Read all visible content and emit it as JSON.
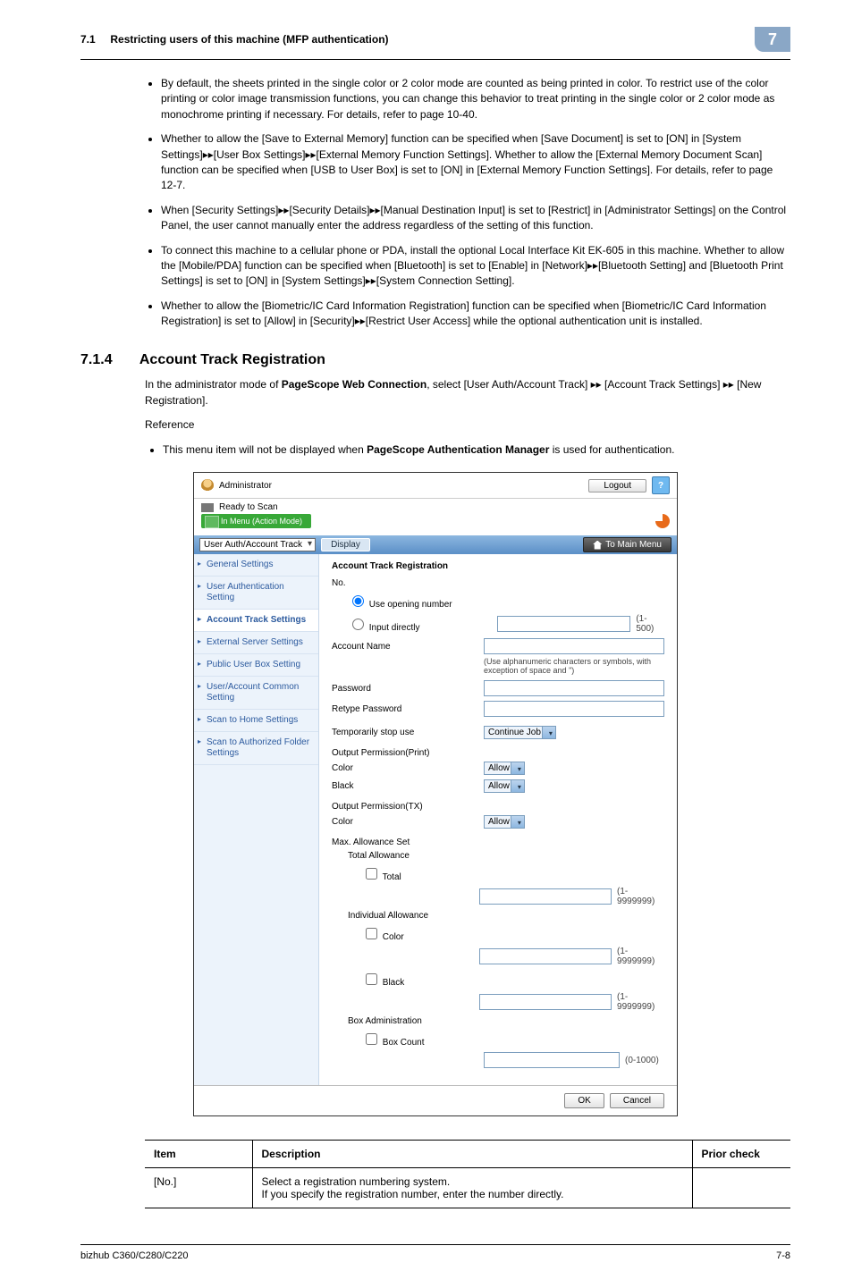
{
  "header": {
    "section_no_label": "7.1",
    "section_title": "Restricting users of this machine (MFP authentication)",
    "chapter_badge": "7"
  },
  "bullets": [
    "By default, the sheets printed in the single color or 2 color mode are counted as being printed in color. To restrict use of the color printing or color image transmission functions, you can change this behavior to treat printing in the single color or 2 color mode as monochrome printing if necessary. For details, refer to page 10-40.",
    "Whether to allow the [Save to External Memory] function can be specified when [Save Document] is set to [ON] in [System Settings]▸▸[User Box Settings]▸▸[External Memory Function Settings]. Whether to allow the [External Memory Document Scan] function can be specified when [USB to User Box] is set to [ON] in [External Memory Function Settings]. For details, refer to page 12-7.",
    "When [Security Settings]▸▸[Security Details]▸▸[Manual Destination Input] is set to [Restrict] in [Administrator Settings] on the Control Panel, the user cannot manually enter the address regardless of the setting of this function.",
    "To connect this machine to a cellular phone or PDA, install the optional Local Interface Kit EK-605 in this machine. Whether to allow the [Mobile/PDA] function can be specified when [Bluetooth] is set to [Enable] in [Network]▸▸[Bluetooth Setting] and [Bluetooth Print Settings] is set to [ON] in [System Settings]▸▸[System Connection Setting].",
    "Whether to allow the [Biometric/IC Card Information Registration] function can be specified when [Biometric/IC Card Information Registration] is set to [Allow] in [Security]▸▸[Restrict User Access] while the optional authentication unit is installed."
  ],
  "section": {
    "number": "7.1.4",
    "title": "Account Track Registration",
    "intro_prefix": "In the administrator mode of ",
    "intro_bold1": "PageScope Web Connection",
    "intro_mid": ", select [User Auth/Account Track] ▸▸ [Account Track Settings] ▸▸ [New Registration].",
    "reference_label": "Reference",
    "ref_item_prefix": "This menu item will not be displayed when ",
    "ref_item_bold": "PageScope Authentication Manager",
    "ref_item_suffix": " is used for authentication."
  },
  "shot": {
    "admin_label": "Administrator",
    "logout": "Logout",
    "help": "?",
    "ready": "Ready to Scan",
    "mode": "In Menu (Action Mode)",
    "bar_select": "User Auth/Account Track",
    "bar_display": "Display",
    "to_main": "To Main Menu",
    "nav": [
      "General Settings",
      "User Authentication Setting",
      "Account Track Settings",
      "External Server Settings",
      "Public User Box Setting",
      "User/Account Common Setting",
      "Scan to Home Settings",
      "Scan to Authorized Folder Settings"
    ],
    "nav_active_index": 2,
    "form": {
      "title": "Account Track Registration",
      "no_label": "No.",
      "radio1": "Use opening number",
      "radio2": "Input directly",
      "input_directly_range": "(1-500)",
      "account_name": "Account Name",
      "account_name_hint": "(Use alphanumeric characters or symbols, with exception of space and \")",
      "password": "Password",
      "retype_password": "Retype Password",
      "temp_stop": "Temporarily stop use",
      "temp_stop_value": "Continue Job",
      "output_perm_print": "Output Permission(Print)",
      "color": "Color",
      "black": "Black",
      "allow": "Allow",
      "output_perm_tx": "Output Permission(TX)",
      "max_allow_set": "Max. Allowance Set",
      "total_allow": "Total Allowance",
      "cb_total": "Total",
      "range_big": "(1-9999999)",
      "indiv_allow": "Individual Allowance",
      "cb_color": "Color",
      "cb_black": "Black",
      "box_admin": "Box Administration",
      "cb_box_count": "Box Count",
      "range_small": "(0-1000)"
    },
    "ok": "OK",
    "cancel": "Cancel"
  },
  "table": {
    "headers": {
      "item": "Item",
      "desc": "Description",
      "prior": "Prior check"
    },
    "rows": [
      {
        "item": "[No.]",
        "desc": "Select a registration numbering system.\nIf you specify the registration number, enter the number directly.",
        "prior": ""
      }
    ]
  },
  "footer": {
    "left": "bizhub C360/C280/C220",
    "right": "7-8"
  }
}
